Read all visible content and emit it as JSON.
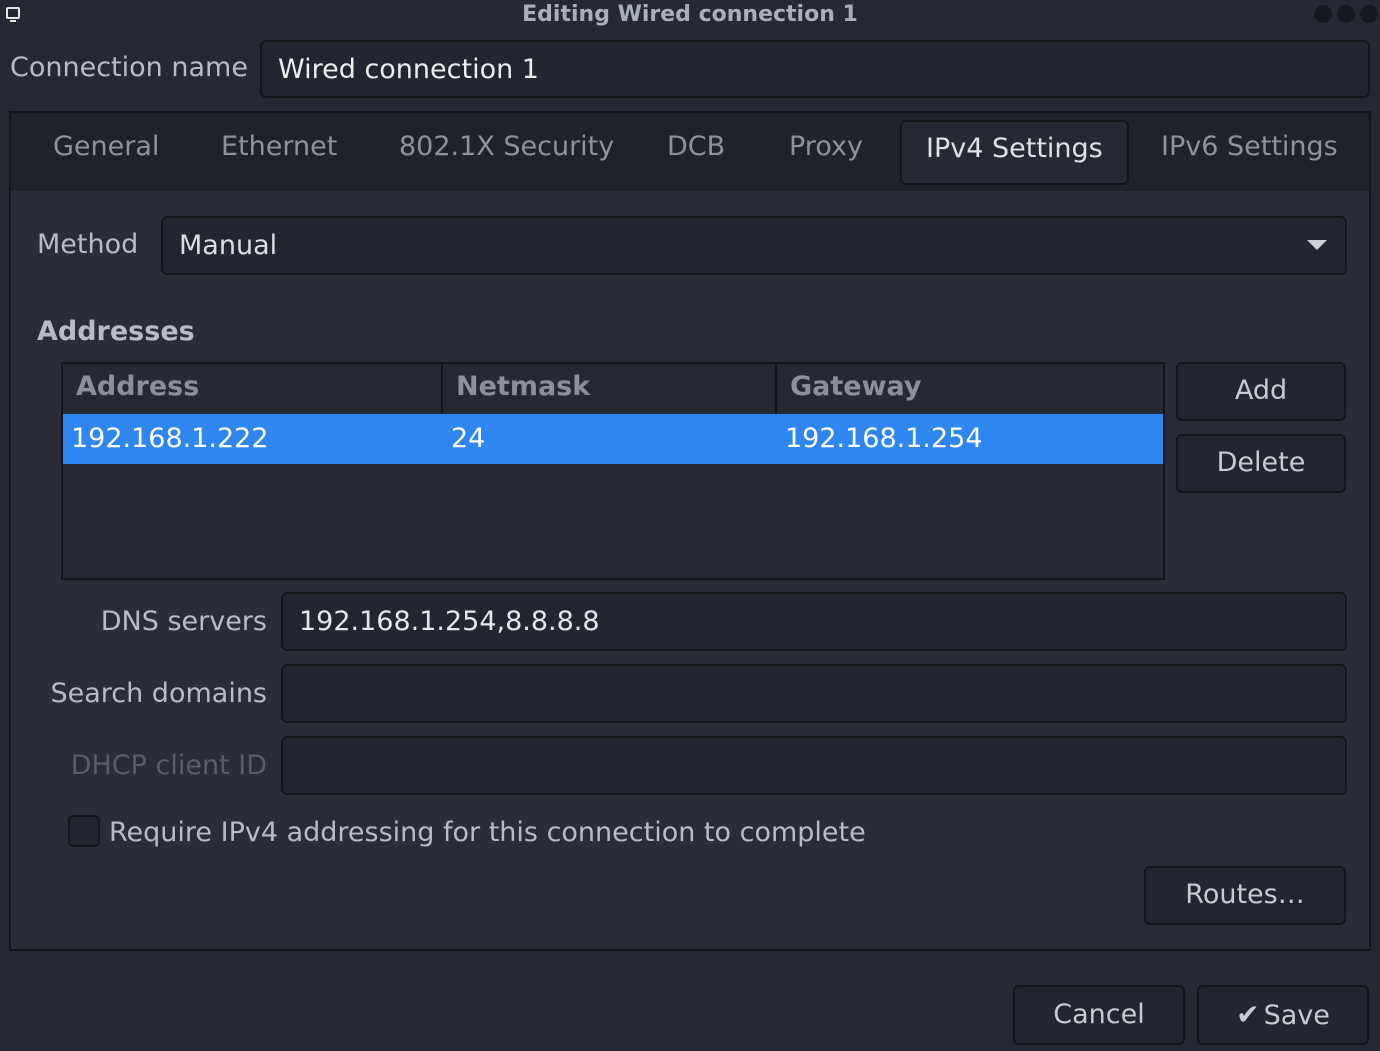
{
  "window": {
    "title": "Editing Wired connection 1"
  },
  "connection": {
    "name_label": "Connection name",
    "name_value": "Wired connection 1"
  },
  "tabs": [
    {
      "label": "General"
    },
    {
      "label": "Ethernet"
    },
    {
      "label": "802.1X Security"
    },
    {
      "label": "DCB"
    },
    {
      "label": "Proxy"
    },
    {
      "label": "IPv4 Settings",
      "active": true
    },
    {
      "label": "IPv6 Settings"
    }
  ],
  "ipv4": {
    "method_label": "Method",
    "method_value": "Manual",
    "addresses_heading": "Addresses",
    "columns": [
      "Address",
      "Netmask",
      "Gateway"
    ],
    "rows": [
      {
        "address": "192.168.1.222",
        "netmask": "24",
        "gateway": "192.168.1.254",
        "selected": true
      }
    ],
    "add_label": "Add",
    "delete_label": "Delete",
    "dns_label": "DNS servers",
    "dns_value": "192.168.1.254,8.8.8.8",
    "search_label": "Search domains",
    "search_value": "",
    "dhcp_label": "DHCP client ID",
    "dhcp_value": "",
    "require_label": "Require IPv4 addressing for this connection to complete",
    "require_checked": false,
    "routes_label": "Routes…"
  },
  "footer": {
    "cancel_label": "Cancel",
    "save_label": "Save",
    "save_icon": "checkmark-icon"
  },
  "colors": {
    "background": "#262934",
    "selection": "#2e86f0",
    "border": "#141519"
  }
}
